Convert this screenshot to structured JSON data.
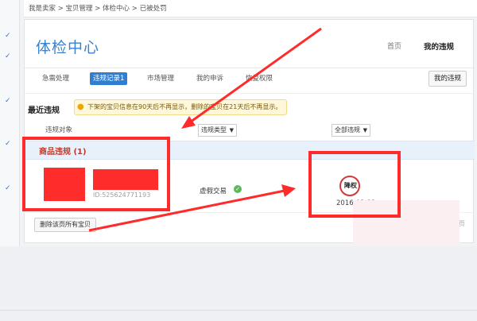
{
  "breadcrumb": "我是卖家 > 宝贝管理 > 体检中心 > 已被处罚",
  "header": {
    "title": "体检中心",
    "home_link": "首页",
    "my_violation_link": "我的违规"
  },
  "nav": {
    "tabs": [
      {
        "label": "急需处理",
        "active": false
      },
      {
        "label": "违规记录1",
        "active": true
      },
      {
        "label": "市场管理",
        "active": false
      },
      {
        "label": "我的申诉",
        "active": false
      },
      {
        "label": "恢复权限",
        "active": false
      }
    ],
    "my_violation_button": "我的违规"
  },
  "recent": {
    "label": "最近违规",
    "notice": "下架的宝贝信息在90天后不再显示，删除的宝贝在21天后不再显示。"
  },
  "table": {
    "col_object": "违规对象",
    "filter_type": "违规类型",
    "filter_all": "全部违规"
  },
  "category": {
    "title": "商品违规 (1)"
  },
  "item": {
    "id_text": "ID:525624771193",
    "violation_type": "虚假交易",
    "penalty_label": "降权",
    "penalty_date": "2016-03-12"
  },
  "footer": {
    "delete_button": "删除该页所有宝贝",
    "page_label": "一页"
  },
  "annotation_color": "#ff2b2b",
  "accent_blue": "#2f7ed1"
}
